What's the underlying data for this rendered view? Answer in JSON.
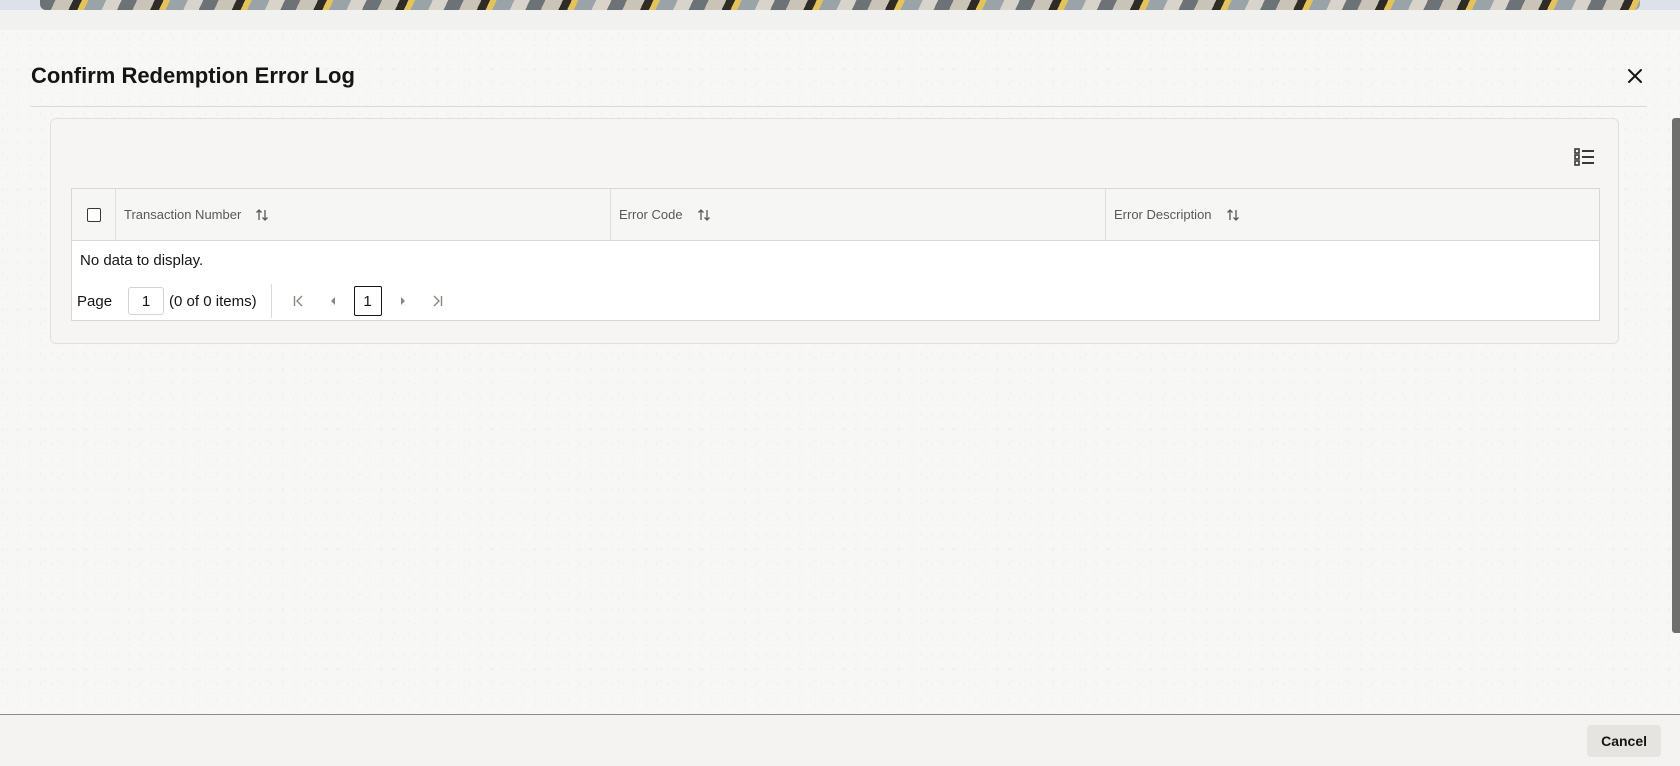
{
  "dialog": {
    "title": "Confirm Redemption Error Log",
    "close_icon": "close-icon"
  },
  "toolbar": {
    "column_manager_icon": "list-settings-icon"
  },
  "table": {
    "columns": [
      {
        "label": "Transaction Number",
        "sort_icon": "sort-icon"
      },
      {
        "label": "Error Code",
        "sort_icon": "sort-icon"
      },
      {
        "label": "Error Description",
        "sort_icon": "sort-icon"
      }
    ],
    "rows": [],
    "empty_message": "No data to display."
  },
  "pagination": {
    "page_label": "Page",
    "page_input_value": "1",
    "item_count": "(0 of 0 items)",
    "current_page": "1",
    "first_icon": "first-page-icon",
    "prev_icon": "previous-page-icon",
    "next_icon": "next-page-icon",
    "last_icon": "last-page-icon"
  },
  "footer": {
    "cancel_label": "Cancel"
  }
}
